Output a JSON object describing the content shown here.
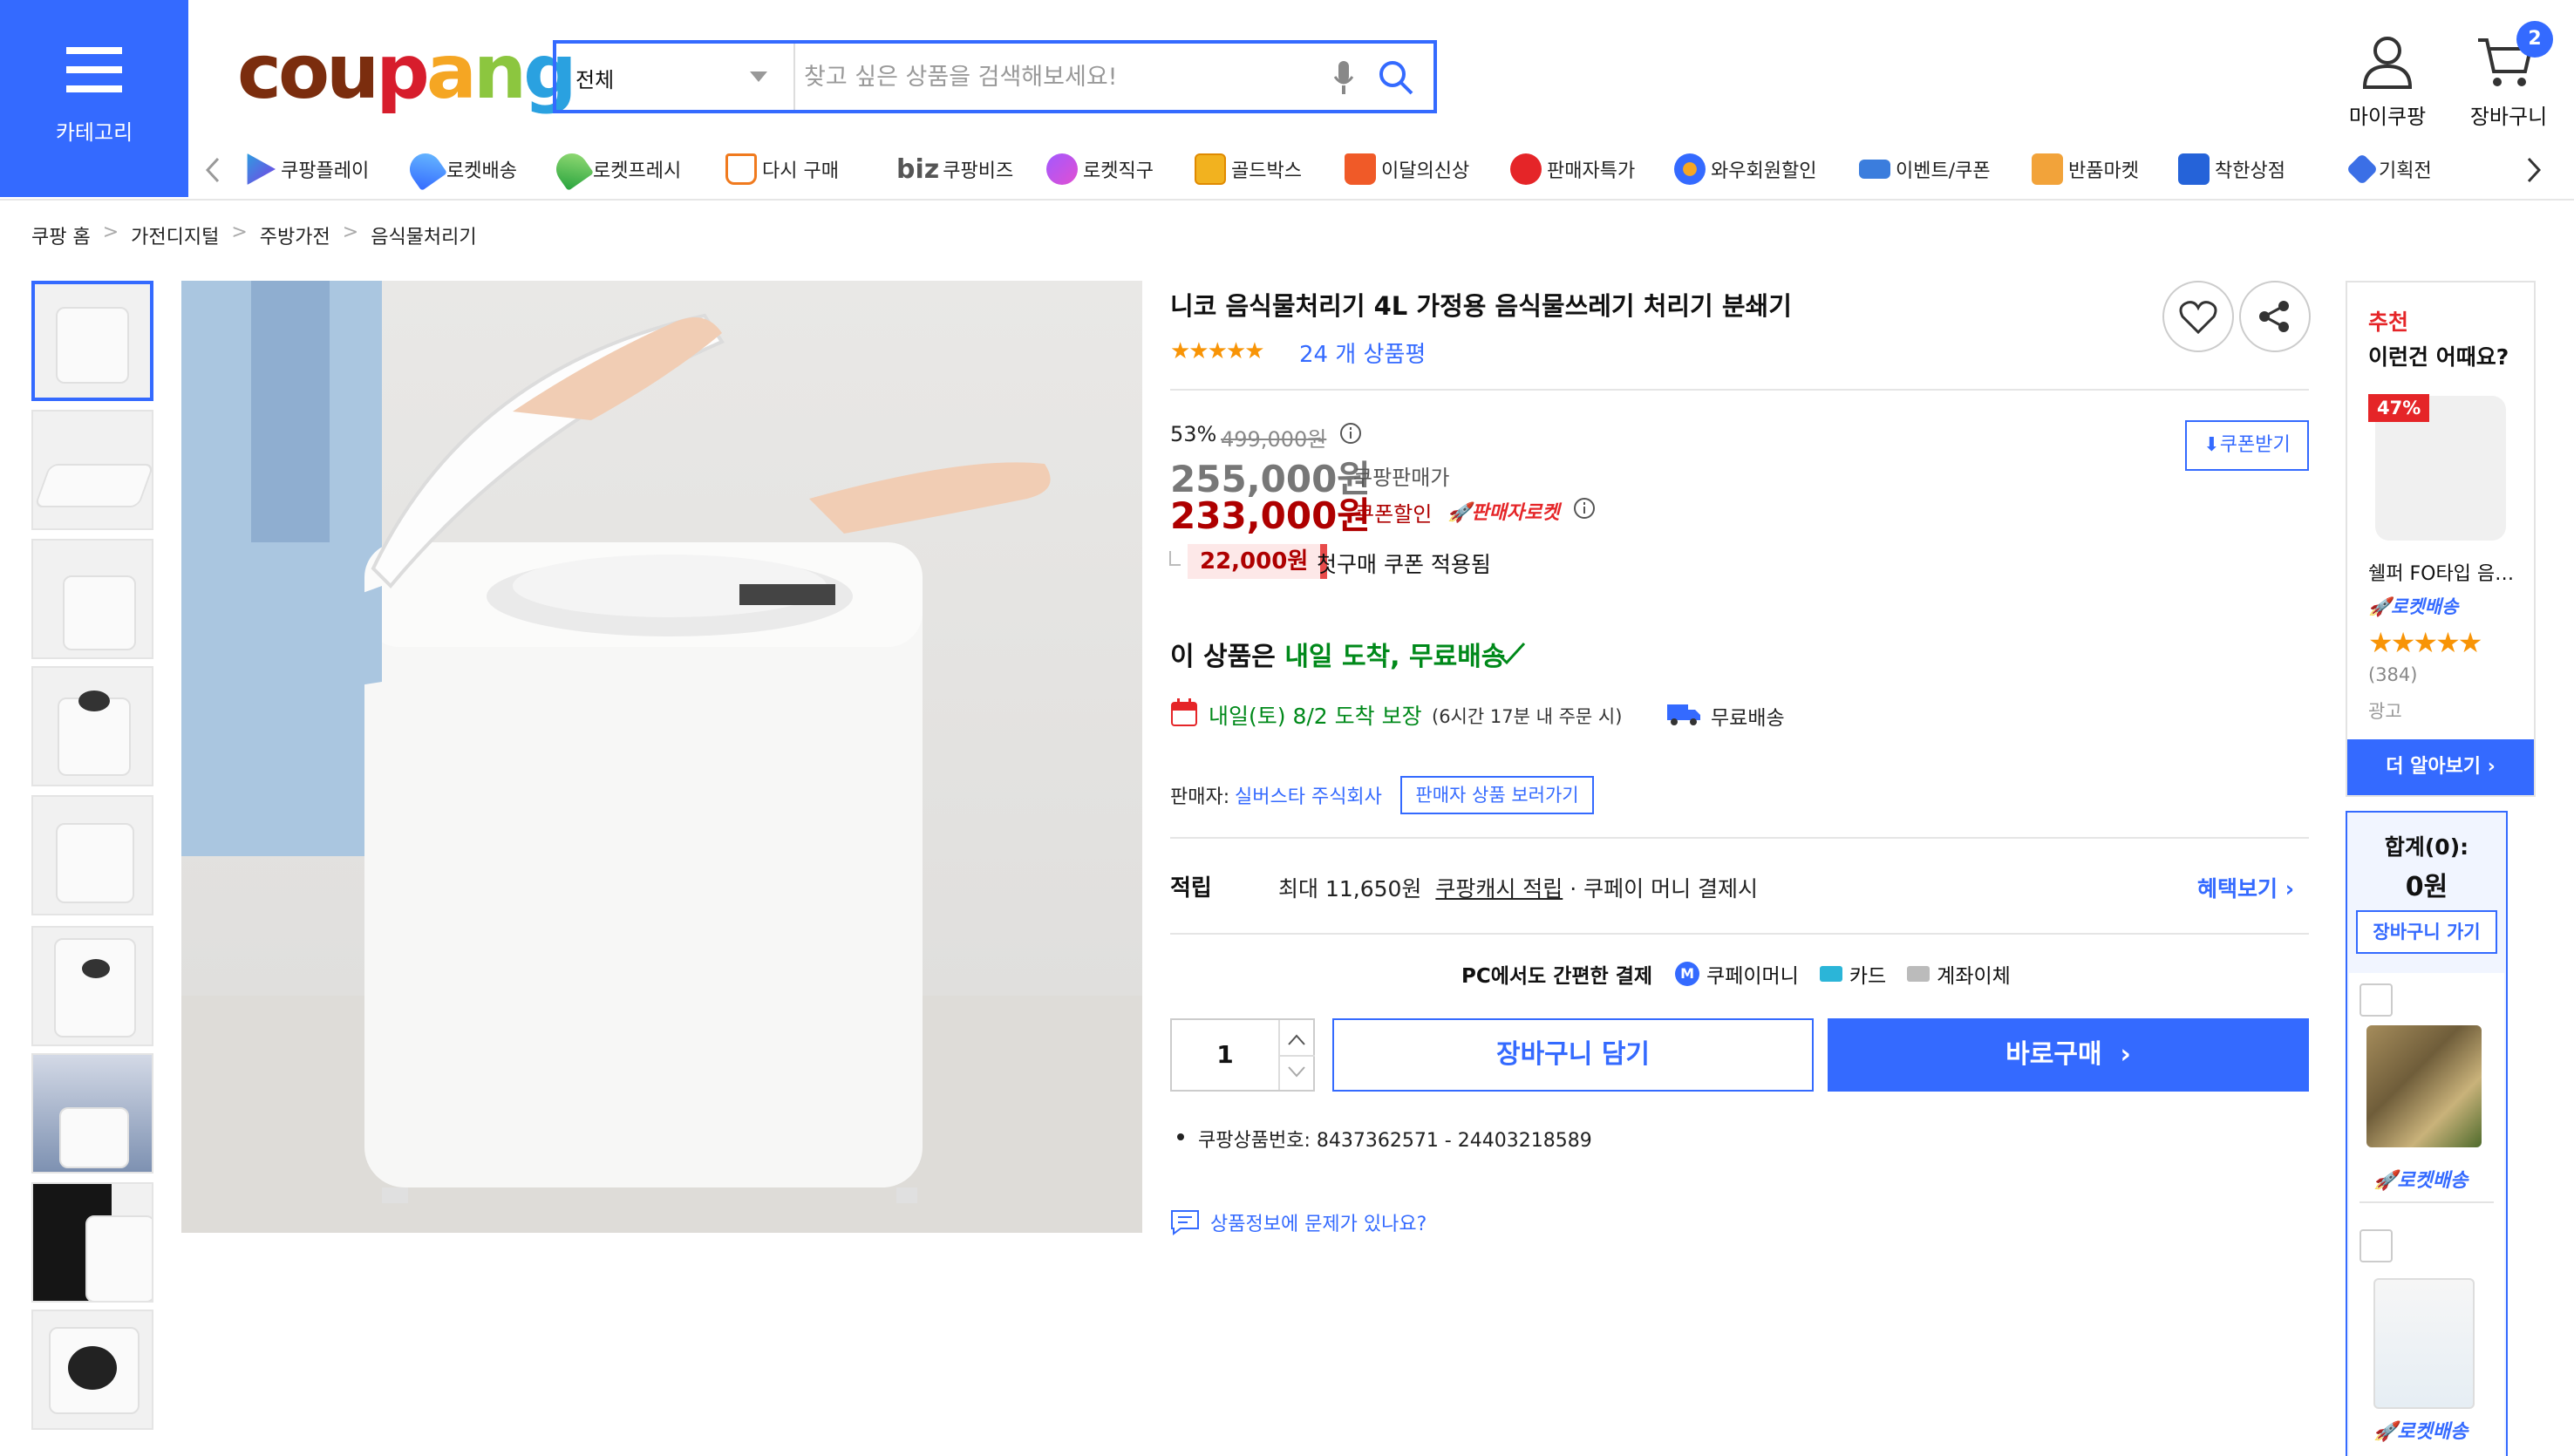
{
  "header": {
    "category_label": "카테고리",
    "logo_text": "coupang",
    "search": {
      "category": "전체",
      "placeholder": "찾고 싶은 상품을 검색해보세요!"
    },
    "my_label": "마이쿠팡",
    "cart_label": "장바구니",
    "cart_count": "2"
  },
  "nav": [
    {
      "label": "쿠팡플레이",
      "icon": "play-icon"
    },
    {
      "label": "로켓배송",
      "icon": "rocket-icon"
    },
    {
      "label": "로켓프레시",
      "icon": "rocket-fresh-icon"
    },
    {
      "label": "다시 구매",
      "icon": "basket-icon"
    },
    {
      "label": "쿠팡비즈",
      "icon": "biz-icon",
      "prefix": "biz"
    },
    {
      "label": "로켓직구",
      "icon": "global-rocket-icon"
    },
    {
      "label": "골드박스",
      "icon": "goldbox-icon"
    },
    {
      "label": "이달의신상",
      "icon": "new-bag-icon"
    },
    {
      "label": "판매자특가",
      "icon": "percent-icon"
    },
    {
      "label": "와우회원할인",
      "icon": "wow-icon"
    },
    {
      "label": "이벤트/쿠폰",
      "icon": "coupon-icon"
    },
    {
      "label": "반품마켓",
      "icon": "return-market-icon"
    },
    {
      "label": "착한상점",
      "icon": "store-icon"
    },
    {
      "label": "기획전",
      "icon": "tag-icon"
    }
  ],
  "breadcrumb": [
    "쿠팡 홈",
    "가전디지털",
    "주방가전",
    "음식물처리기"
  ],
  "product": {
    "title": "니코 음식물처리기 4L 가정용 음식물쓰레기 처리기 분쇄기",
    "stars": "★★★★★",
    "review_count": "24 개 상품평",
    "discount_pct": "53%",
    "original_price": "499,000원",
    "price": "255,000원",
    "price_label": "쿠팡판매가",
    "coupon_price": "233,000원",
    "coupon_price_label": "쿠폰할인",
    "seller_rocket": "🚀판매자로켓",
    "coupon_button": "쿠폰받기",
    "coupon_amount": "22,000원",
    "coupon_note": "첫구매 쿠폰 적용됨",
    "delivery_prefix": "이 상품은",
    "delivery_highlight": "내일 도착, 무료배송",
    "arrival": "내일(토) 8/2 도착 보장",
    "arrival_sub": "(6시간 17분 내 주문 시)",
    "free_shipping": "무료배송",
    "seller_label": "판매자:",
    "seller_name": "실버스타 주식회사",
    "seller_button": "판매자 상품 보러가기",
    "reward_label": "적립",
    "reward_max": "최대 11,650원",
    "reward_cash": "쿠팡캐시 적립",
    "reward_rest": "· 쿠페이 머니 결제시",
    "benefit_link": "혜택보기",
    "pay_title": "PC에서도 간편한 결제",
    "pay_methods": [
      "쿠페이머니",
      "카드",
      "계좌이체"
    ],
    "quantity": "1",
    "cart_button": "장바구니 담기",
    "buy_button": "바로구매",
    "product_id": "쿠팡상품번호: 8437362571 - 24403218589",
    "report_link": "상품정보에 문제가 있나요?"
  },
  "recommend": {
    "title1": "추천",
    "title2": "이런건 어때요?",
    "discount": "47%",
    "name": "쉘퍼 FO타입 음…",
    "rocket": "로켓배송",
    "stars": "★★★★★",
    "count": "(384)",
    "ad": "광고",
    "more": "더 알아보기"
  },
  "cart_panel": {
    "sum_label": "합계(0):",
    "amount": "0원",
    "go_button": "장바구니 가기",
    "item1_rocket": "로켓배송",
    "item2_rocket": "로켓배송"
  },
  "colors": {
    "accent": "#346aff",
    "sale": "#ae0000",
    "green": "#00891a"
  }
}
